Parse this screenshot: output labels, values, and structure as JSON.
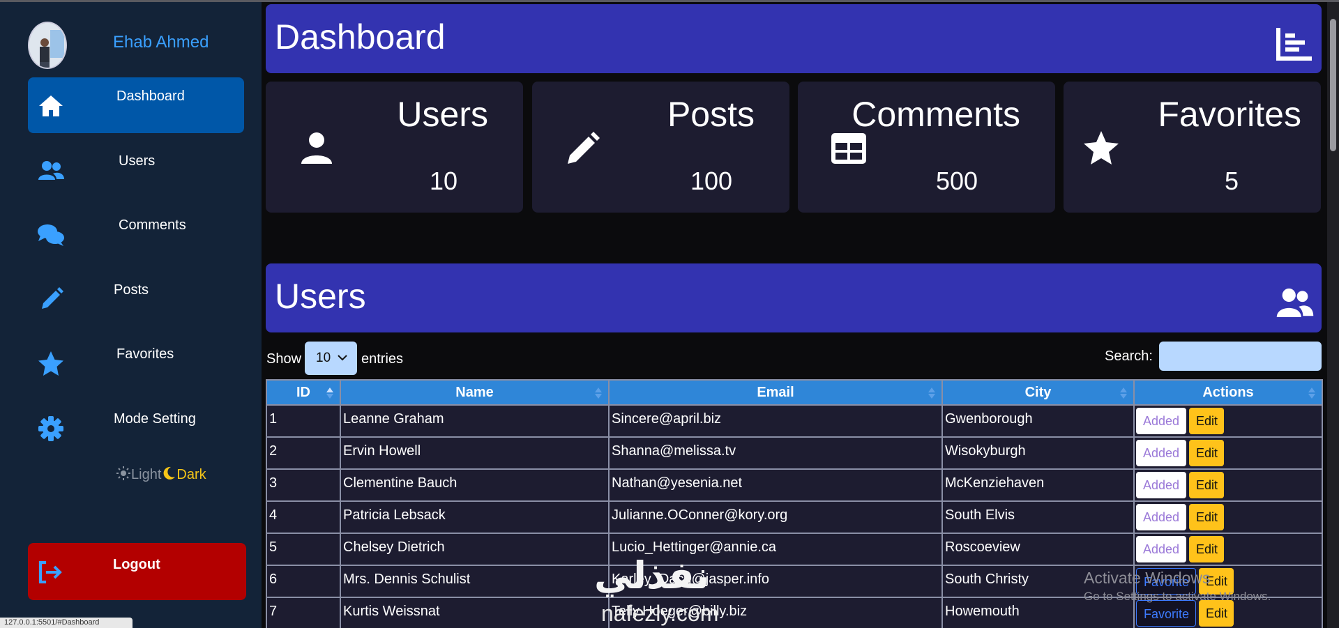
{
  "profile": {
    "name": "Ehab Ahmed"
  },
  "sidebar": {
    "items": [
      {
        "label": "Dashboard",
        "icon": "home-icon"
      },
      {
        "label": "Users",
        "icon": "users-icon"
      },
      {
        "label": "Comments",
        "icon": "comments-icon"
      },
      {
        "label": "Posts",
        "icon": "pencil-icon"
      },
      {
        "label": "Favorites",
        "icon": "star-icon"
      },
      {
        "label": "Mode Setting",
        "icon": "gear-icon"
      }
    ],
    "mode": {
      "light": "Light",
      "dark": "Dark"
    },
    "logout": "Logout"
  },
  "dashboard": {
    "title": "Dashboard",
    "icon": "chart-bar-icon"
  },
  "cards": [
    {
      "title": "Users",
      "value": "10",
      "icon": "user-icon"
    },
    {
      "title": "Posts",
      "value": "100",
      "icon": "pencil-icon"
    },
    {
      "title": "Comments",
      "value": "500",
      "icon": "table-icon"
    },
    {
      "title": "Favorites",
      "value": "5",
      "icon": "star-icon"
    }
  ],
  "users_section": {
    "title": "Users",
    "icon": "users-icon",
    "show_label": "Show",
    "entries_value": "10",
    "entries_label": "entries",
    "search_label": "Search:",
    "search_value": "",
    "columns": [
      "ID",
      "Name",
      "Email",
      "City",
      "Actions"
    ],
    "rows": [
      {
        "id": "1",
        "name": "Leanne Graham",
        "email": "Sincere@april.biz",
        "city": "Gwenborough",
        "fav": "Added",
        "edit": "Edit"
      },
      {
        "id": "2",
        "name": "Ervin Howell",
        "email": "Shanna@melissa.tv",
        "city": "Wisokyburgh",
        "fav": "Added",
        "edit": "Edit"
      },
      {
        "id": "3",
        "name": "Clementine Bauch",
        "email": "Nathan@yesenia.net",
        "city": "McKenziehaven",
        "fav": "Added",
        "edit": "Edit"
      },
      {
        "id": "4",
        "name": "Patricia Lebsack",
        "email": "Julianne.OConner@kory.org",
        "city": "South Elvis",
        "fav": "Added",
        "edit": "Edit"
      },
      {
        "id": "5",
        "name": "Chelsey Dietrich",
        "email": "Lucio_Hettinger@annie.ca",
        "city": "Roscoeview",
        "fav": "Added",
        "edit": "Edit"
      },
      {
        "id": "6",
        "name": "Mrs. Dennis Schulist",
        "email": "Karley_Dach@jasper.info",
        "city": "South Christy",
        "fav": "Favorite",
        "edit": "Edit"
      },
      {
        "id": "7",
        "name": "Kurtis Weissnat",
        "email": "Telly.Hoeger@billy.biz",
        "city": "Howemouth",
        "fav": "Favorite",
        "edit": "Edit"
      }
    ]
  },
  "status_url": "127.0.0.1:5501/#Dashboard",
  "watermarks": {
    "activate_title": "Activate Windows",
    "activate_sub": "Go to Settings to activate Windows.",
    "brand": "نفذلي",
    "brand_sub": "nafezly.com"
  }
}
